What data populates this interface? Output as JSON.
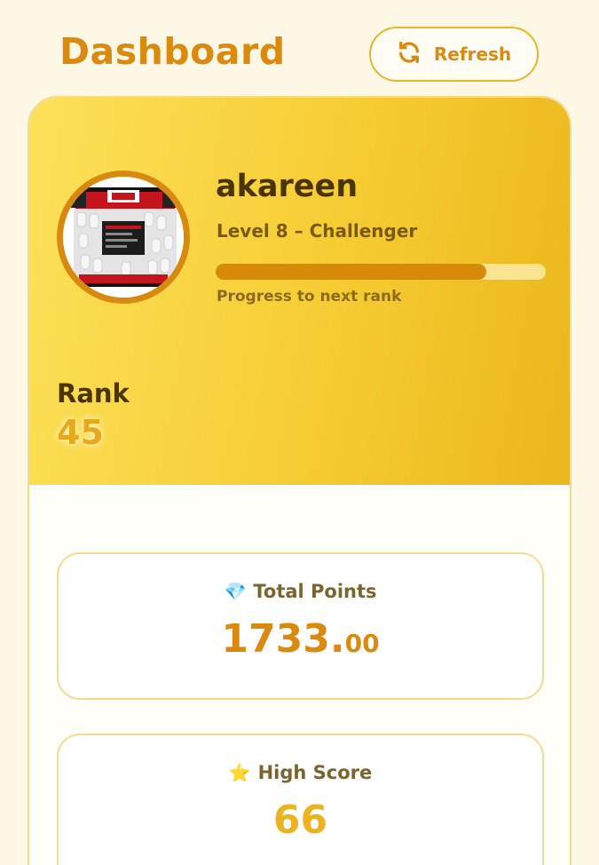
{
  "header": {
    "title": "Dashboard",
    "refresh_label": "Refresh",
    "refresh_icon": "refresh-icon"
  },
  "profile": {
    "username": "akareen",
    "level": "Level 8 – Challenger",
    "progress_fraction": 0.82,
    "progress_label": "Progress to next rank",
    "rank_label": "Rank",
    "rank_value": "45",
    "avatar_icon": "product-bag-image"
  },
  "stats": {
    "total_points": {
      "icon": "💎",
      "label": "Total Points",
      "value_int": "1733.",
      "value_dec": "00"
    },
    "high_score": {
      "icon": "⭐",
      "label": "High Score",
      "value": "66"
    }
  },
  "colors": {
    "accent": "#d98a0f",
    "gold": "#ebb320",
    "card_gradient_start": "#fce15a",
    "card_gradient_end": "#eab71c",
    "dark_text": "#4a3500"
  }
}
